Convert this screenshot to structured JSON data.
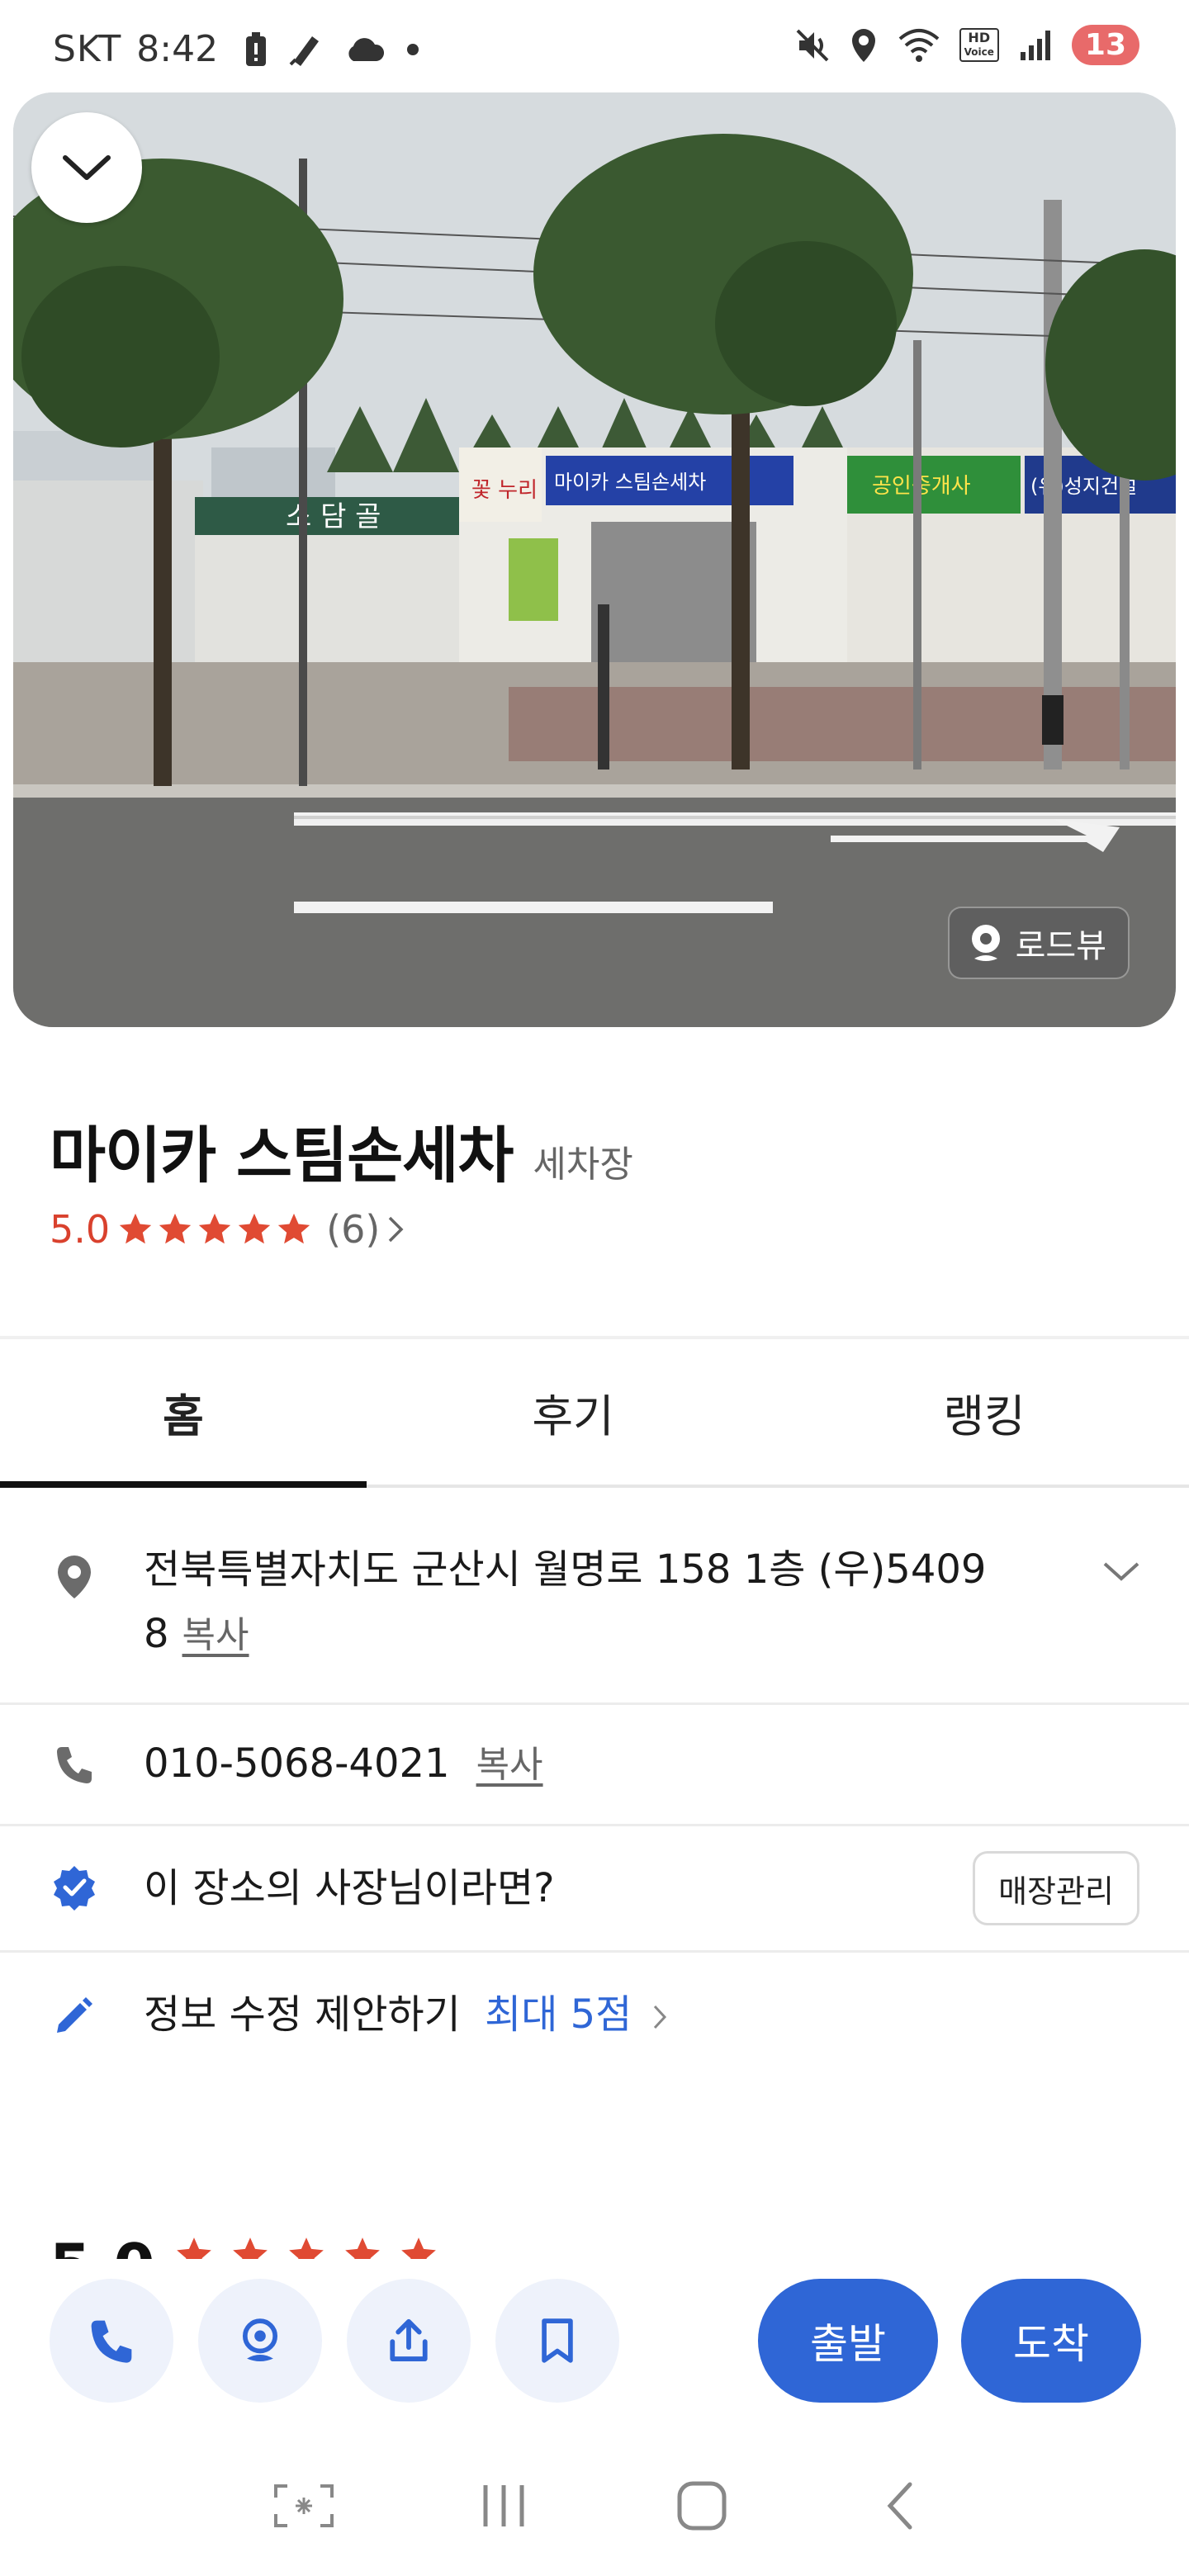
{
  "status_bar": {
    "carrier": "SKT",
    "time": "8:42",
    "battery_badge": "13",
    "hd_voice_top": "HD",
    "hd_voice_bottom": "Voice"
  },
  "photo": {
    "roadview_label": "로드뷰",
    "sign_texts": [
      "소 담 골",
      "꽃 누리",
      "마이카 스팀손세차",
      "공인중개사",
      "(유)성지건설"
    ]
  },
  "place": {
    "name": "마이카 스팀손세차",
    "category": "세차장",
    "rating": "5.0",
    "review_count": "(6)",
    "stars": 5
  },
  "tabs": [
    {
      "label": "홈",
      "active": true
    },
    {
      "label": "후기",
      "active": false
    },
    {
      "label": "랭킹",
      "active": false
    }
  ],
  "info": {
    "address_line1": "전북특별자치도 군산시 월명로 158 1층 (우)5409",
    "address_line2": "8",
    "copy_label": "복사",
    "phone": "010-5068-4021",
    "owner_question": "이 장소의 사장님이라면?",
    "manage_label": "매장관리",
    "suggest_label": "정보 수정 제안하기",
    "suggest_points": "최대 5점"
  },
  "actions": {
    "depart_label": "출발",
    "arrive_label": "도착"
  },
  "colors": {
    "accent": "#2f66d6",
    "rating_red": "#d9412d",
    "action_bg": "#eef2fb"
  }
}
